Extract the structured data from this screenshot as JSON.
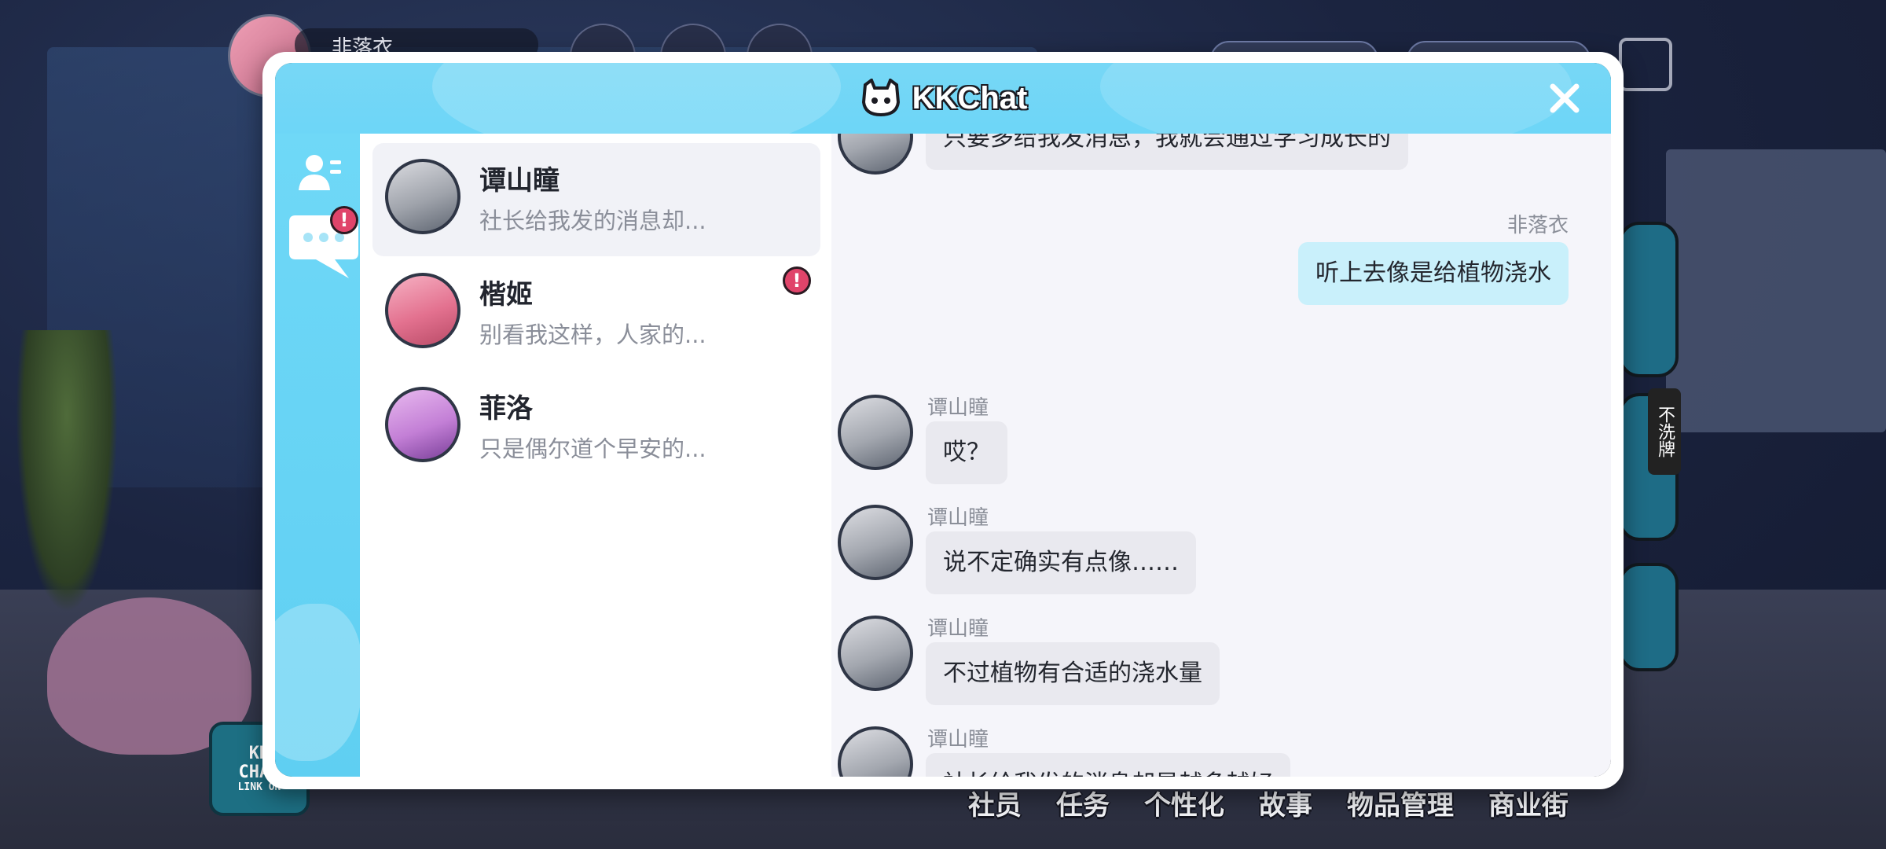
{
  "hud": {
    "player_name": "非落衣"
  },
  "launcher": {
    "label_line1": "KK",
    "label_line2": "CHAT",
    "label_line3": "LINK ON"
  },
  "right_tab": {
    "label": "不洗牌"
  },
  "bottom_nav": {
    "items": [
      {
        "label": "社员"
      },
      {
        "label": "任务"
      },
      {
        "label": "个性化"
      },
      {
        "label": "故事"
      },
      {
        "label": "物品管理"
      },
      {
        "label": "商业街"
      }
    ]
  },
  "dialog": {
    "title": "KKChat",
    "close_icon": "close-icon",
    "rail": {
      "contacts_icon": "contacts-icon",
      "chats_icon": "chat-bubble-icon",
      "chats_alert": "!"
    },
    "contacts": [
      {
        "name": "谭山瞳",
        "preview": "社长给我发的消息却...",
        "active": true,
        "alert": ""
      },
      {
        "name": "楷姬",
        "preview": "别看我这样，人家的...",
        "active": false,
        "alert": "!"
      },
      {
        "name": "菲洛",
        "preview": "只是偶尔道个早安的...",
        "active": false,
        "alert": ""
      }
    ],
    "messages": [
      {
        "sender": "",
        "text": "只要多给我发消息，我就会通过学习成长的",
        "outgoing": false
      },
      {
        "sender": "非落衣",
        "text": "听上去像是给植物浇水",
        "outgoing": true
      },
      {
        "sender": "谭山瞳",
        "text": "哎？",
        "outgoing": false
      },
      {
        "sender": "谭山瞳",
        "text": "说不定确实有点像……",
        "outgoing": false
      },
      {
        "sender": "谭山瞳",
        "text": "不过植物有合适的浇水量",
        "outgoing": false
      },
      {
        "sender": "谭山瞳",
        "text": "社长给我发的消息却是越多越好",
        "outgoing": false
      }
    ]
  },
  "colors": {
    "title_bar": "#6dd6f7",
    "outgoing_bubble": "#c9f0fb",
    "incoming_bubble": "#e9e9ef",
    "alert": "#e0446a"
  }
}
